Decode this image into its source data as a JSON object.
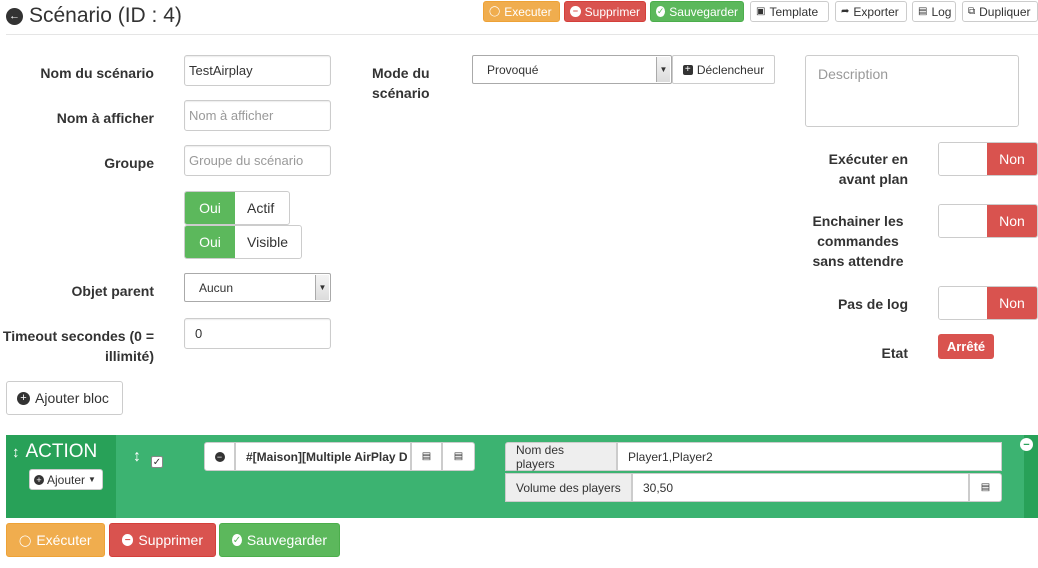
{
  "header": {
    "title": "Scénario (ID : 4)",
    "toolbar": {
      "execute": "Executer",
      "delete": "Supprimer",
      "save": "Sauvegarder",
      "template": "Template",
      "export": "Exporter",
      "log": "Log",
      "duplicate": "Dupliquer"
    }
  },
  "form": {
    "name_label": "Nom du scénario",
    "name_value": "TestAirplay",
    "display_label": "Nom à afficher",
    "display_placeholder": "Nom à afficher",
    "group_label": "Groupe",
    "group_placeholder": "Groupe du scénario",
    "active_on": "Oui",
    "active_label": "Actif",
    "visible_on": "Oui",
    "visible_label": "Visible",
    "parent_label": "Objet parent",
    "parent_value": "Aucun",
    "timeout_label": "Timeout secondes (0 = illimité)",
    "timeout_value": "0",
    "mode_label": "Mode du scénario",
    "mode_value": "Provoqué",
    "trigger_button": "Déclencheur",
    "description_placeholder": "Description",
    "foreground_label": "Exécuter en avant plan",
    "foreground_value": "Non",
    "chain_label": "Enchainer les commandes sans attendre",
    "chain_value": "Non",
    "nolog_label": "Pas de log",
    "nolog_value": "Non",
    "state_label": "Etat",
    "state_value": "Arrêté"
  },
  "add_block": "Ajouter bloc",
  "block": {
    "title": "ACTION",
    "add_button": "Ajouter",
    "command": "#[Maison][Multiple AirPlay D",
    "players_label": "Nom des players",
    "players_value": "Player1,Player2",
    "volume_label": "Volume des players",
    "volume_value": "30,50"
  },
  "footer": {
    "execute": "Exécuter",
    "delete": "Supprimer",
    "save": "Sauvegarder"
  },
  "colors": {
    "green": "#5cb85c",
    "red": "#d9534f",
    "orange": "#f0ad4e",
    "block_green": "#28a158"
  }
}
